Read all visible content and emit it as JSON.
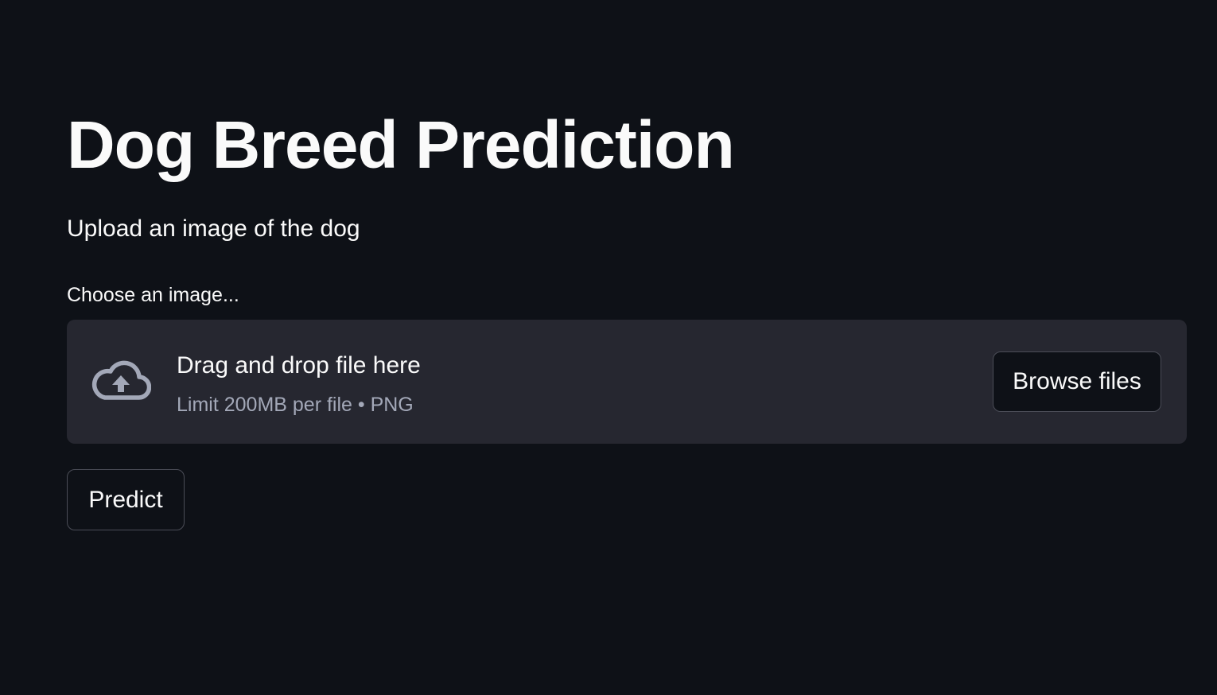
{
  "page": {
    "title": "Dog Breed Prediction",
    "subtitle": "Upload an image of the dog"
  },
  "uploader": {
    "label": "Choose an image...",
    "dropzone_title": "Drag and drop file here",
    "dropzone_limit": "Limit 200MB per file • PNG",
    "browse_label": "Browse files",
    "icon": "cloud-upload-icon"
  },
  "actions": {
    "predict_label": "Predict"
  },
  "colors": {
    "background": "#0e1117",
    "dropzone_bg": "#262730",
    "text": "#fafafa",
    "muted_text": "#a3a8b8",
    "icon": "#a3a8b8",
    "button_border": "#4b4d57"
  }
}
